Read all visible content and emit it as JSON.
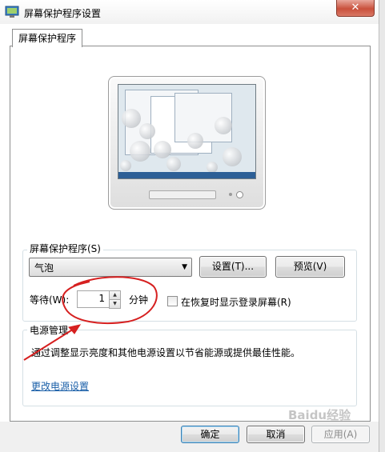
{
  "window": {
    "title": "屏幕保护程序设置",
    "close_glyph": "✕"
  },
  "tab": {
    "label": "屏幕保护程序"
  },
  "screensaver": {
    "group_label": "屏幕保护程序(S)",
    "selected": "气泡",
    "settings_button": "设置(T)...",
    "preview_button": "预览(V)",
    "wait_label": "等待(W):",
    "wait_value": "1",
    "wait_unit": "分钟",
    "resume_checkbox_label": "在恢复时显示登录屏幕(R)",
    "resume_checked": false
  },
  "power": {
    "group_label": "电源管理",
    "description": "通过调整显示亮度和其他电源设置以节省能源或提供最佳性能。",
    "link": "更改电源设置"
  },
  "buttons": {
    "ok": "确定",
    "cancel": "取消",
    "apply": "应用(A)"
  },
  "watermark": "Baidu经验",
  "colors": {
    "annotation": "#d62020",
    "link": "#1a5fa8"
  }
}
